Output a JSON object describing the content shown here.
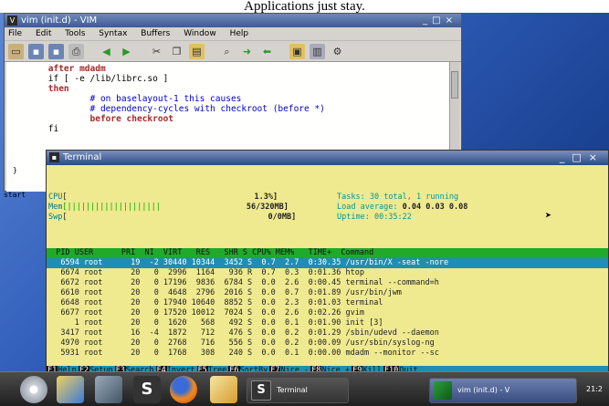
{
  "caption": "Applications just stay.",
  "gvim": {
    "title": "vim (init.d) - VIM",
    "menu": [
      "File",
      "Edit",
      "Tools",
      "Syntax",
      "Buffers",
      "Window",
      "Help"
    ],
    "toolbar_icons": [
      "open-icon",
      "save-icon",
      "save-all-icon",
      "print-icon",
      "undo-icon",
      "redo-icon",
      "cut-icon",
      "copy-icon",
      "paste-icon",
      "find-replace-icon",
      "forward-icon",
      "back-icon",
      "load-session-icon",
      "save-session-icon",
      "run-script-icon"
    ],
    "lines": [
      {
        "cls": "kw",
        "text": "        after mdadm"
      },
      {
        "cls": "st",
        "text": "        if [ -e /lib/librc.so ]"
      },
      {
        "cls": "kw",
        "text": "        then"
      },
      {
        "cls": "cm",
        "text": "                # on baselayout-1 this causes"
      },
      {
        "cls": "cm",
        "text": "                # dependency-cycles with checkroot (before *)"
      },
      {
        "cls": "kw",
        "text": "                before checkroot"
      },
      {
        "cls": "st",
        "text": "        fi"
      }
    ]
  },
  "terminal": {
    "title": "Terminal",
    "meters": [
      {
        "label": "CPU",
        "bar": "[",
        "value": "1.3%]"
      },
      {
        "label": "Mem",
        "bar": "[||||||||||||||||||||",
        "value": "56/320MB]"
      },
      {
        "label": "Swp",
        "bar": "[",
        "value": "0/0MB]"
      }
    ],
    "tasks": {
      "label": "Tasks:",
      "value": "30 total, 1 running"
    },
    "load": {
      "label": "Load average:",
      "v1": "0.04",
      "v2": "0.03",
      "v3": "0.08"
    },
    "uptime": {
      "label": "Uptime:",
      "value": "00:35:22"
    },
    "header": "  PID USER      PRI  NI  VIRT   RES   SHR S CPU% MEM%   TIME+  Command",
    "rows": [
      "   6594 root      19  -2 30440 10344  3452 S  0.7  2.7  0:30.35 /usr/bin/X -seat -nore",
      "   6674 root      20   0  2996  1164   936 R  0.7  0.3  0:01.36 htop",
      "   6672 root      20   0 17196  9836  6784 S  0.0  2.6  0:00.45 terminal --command=h",
      "   6610 root      20   0  4648  2796  2016 S  0.0  0.7  0:01.89 /usr/bin/jwm",
      "   6648 root      20   0 17940 10640  8852 S  0.0  2.3  0:01.03 terminal",
      "   6677 root      20   0 17520 10012  7024 S  0.0  2.6  0:02.26 gvim",
      "      1 root      20   0  1620   568   492 S  0.0  0.1  0:01.90 init [3]",
      "   3417 root      16  -4  1872   712   476 S  0.0  0.2  0:01.29 /sbin/udevd --daemon",
      "   4970 root      20   0  2768   716   556 S  0.0  0.2  0:00.09 /usr/sbin/syslog-ng",
      "   5931 root      20   0  1768   308   240 S  0.0  0.1  0:00.00 mdadm --monitor --sc"
    ],
    "fkeys": [
      {
        "n": "F1",
        "l": "Help"
      },
      {
        "n": "F2",
        "l": "Setup"
      },
      {
        "n": "F3",
        "l": "Search"
      },
      {
        "n": "F4",
        "l": "Invert"
      },
      {
        "n": "F5",
        "l": "Tree"
      },
      {
        "n": "F6",
        "l": "SortBy"
      },
      {
        "n": "F7",
        "l": "Nice -"
      },
      {
        "n": "F8",
        "l": "Nice +"
      },
      {
        "n": "F9",
        "l": "Kill"
      },
      {
        "n": "F10",
        "l": "Quit"
      }
    ]
  },
  "desktop_strip": [
    "}",
    "start"
  ],
  "taskbar": {
    "launchers": [
      "disc-icon",
      "file-manager-icon",
      "settings-icon",
      "terminal-launcher-icon",
      "firefox-icon",
      "mail-icon"
    ],
    "tasks": [
      {
        "label": "Terminal"
      },
      {
        "label": "vim (init.d) - V"
      }
    ],
    "clock": "21:2"
  },
  "colors": {
    "htop_green": "#1faa2a",
    "htop_select": "#1e8fb0",
    "terminal_bg": "#efe98f",
    "desktop": "#2f5cb8"
  }
}
